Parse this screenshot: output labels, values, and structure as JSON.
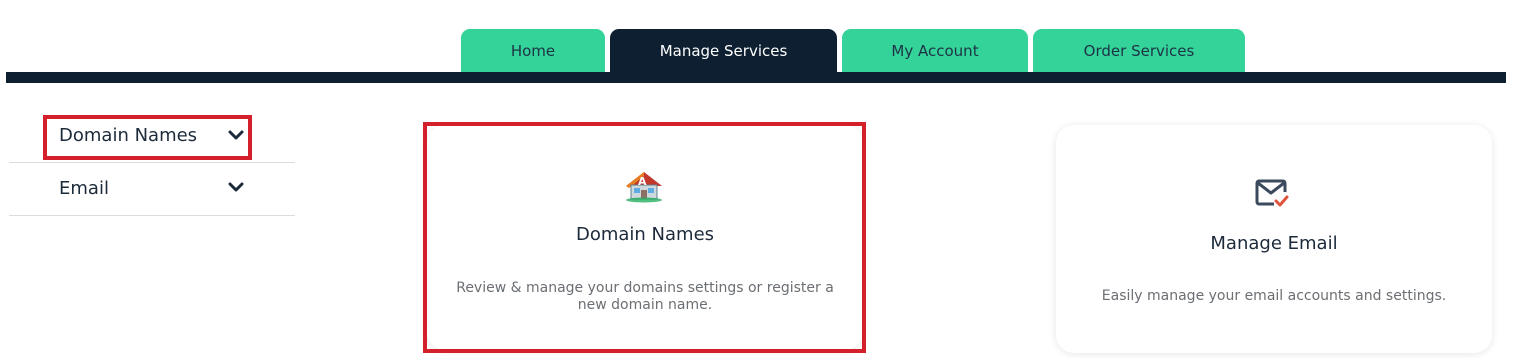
{
  "nav": {
    "tabs": [
      {
        "label": "Home",
        "active": false
      },
      {
        "label": "Manage Services",
        "active": true
      },
      {
        "label": "My Account",
        "active": false
      },
      {
        "label": "Order Services",
        "active": false
      }
    ]
  },
  "sidebar": {
    "items": [
      {
        "label": "Domain Names",
        "icon": "chevron-down-icon",
        "highlighted": true
      },
      {
        "label": "Email",
        "icon": "chevron-down-icon",
        "highlighted": false
      }
    ]
  },
  "cards": [
    {
      "title": "Domain Names",
      "description": "Review & manage your domains settings or register a new domain name.",
      "icon": "domain-house-icon",
      "highlighted": true
    },
    {
      "title": "Manage Email",
      "description": "Easily manage your email accounts and settings.",
      "icon": "email-check-icon",
      "highlighted": false
    }
  ],
  "colors": {
    "tab_inactive": "#34d399",
    "tab_active": "#0d1f30",
    "nav_bar": "#0d1f30",
    "highlight": "#d4202a"
  }
}
